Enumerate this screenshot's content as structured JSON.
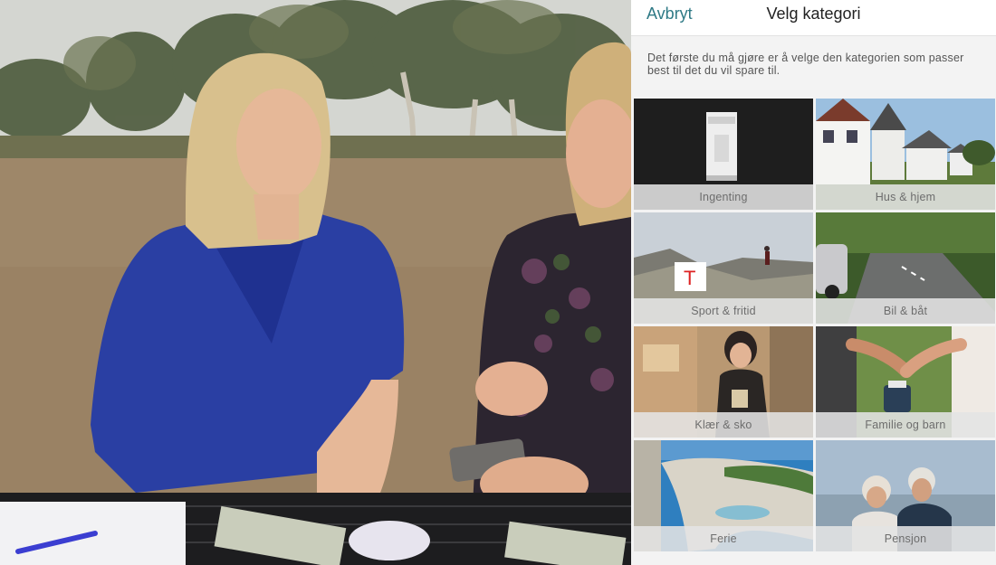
{
  "header": {
    "cancel_label": "Avbryt",
    "title": "Velg kategori"
  },
  "intro_text": "Det første du må gjøre er å velge den kategorien som passer best til det du vil spare til.",
  "categories": [
    {
      "label": "Ingenting",
      "icon": "product-box-image"
    },
    {
      "label": "Hus & hjem",
      "icon": "house-image"
    },
    {
      "label": "Sport & fritid",
      "icon": "mountain-hiker-image"
    },
    {
      "label": "Bil & båt",
      "icon": "car-road-image"
    },
    {
      "label": "Klær & sko",
      "icon": "shopping-woman-image"
    },
    {
      "label": "Familie og barn",
      "icon": "family-hands-image"
    },
    {
      "label": "Ferie",
      "icon": "beach-cove-image"
    },
    {
      "label": "Pensjon",
      "icon": "elderly-couple-image"
    }
  ],
  "colors": {
    "accent": "#2f7a86",
    "tile_label_bg": "#e4e4e4"
  }
}
